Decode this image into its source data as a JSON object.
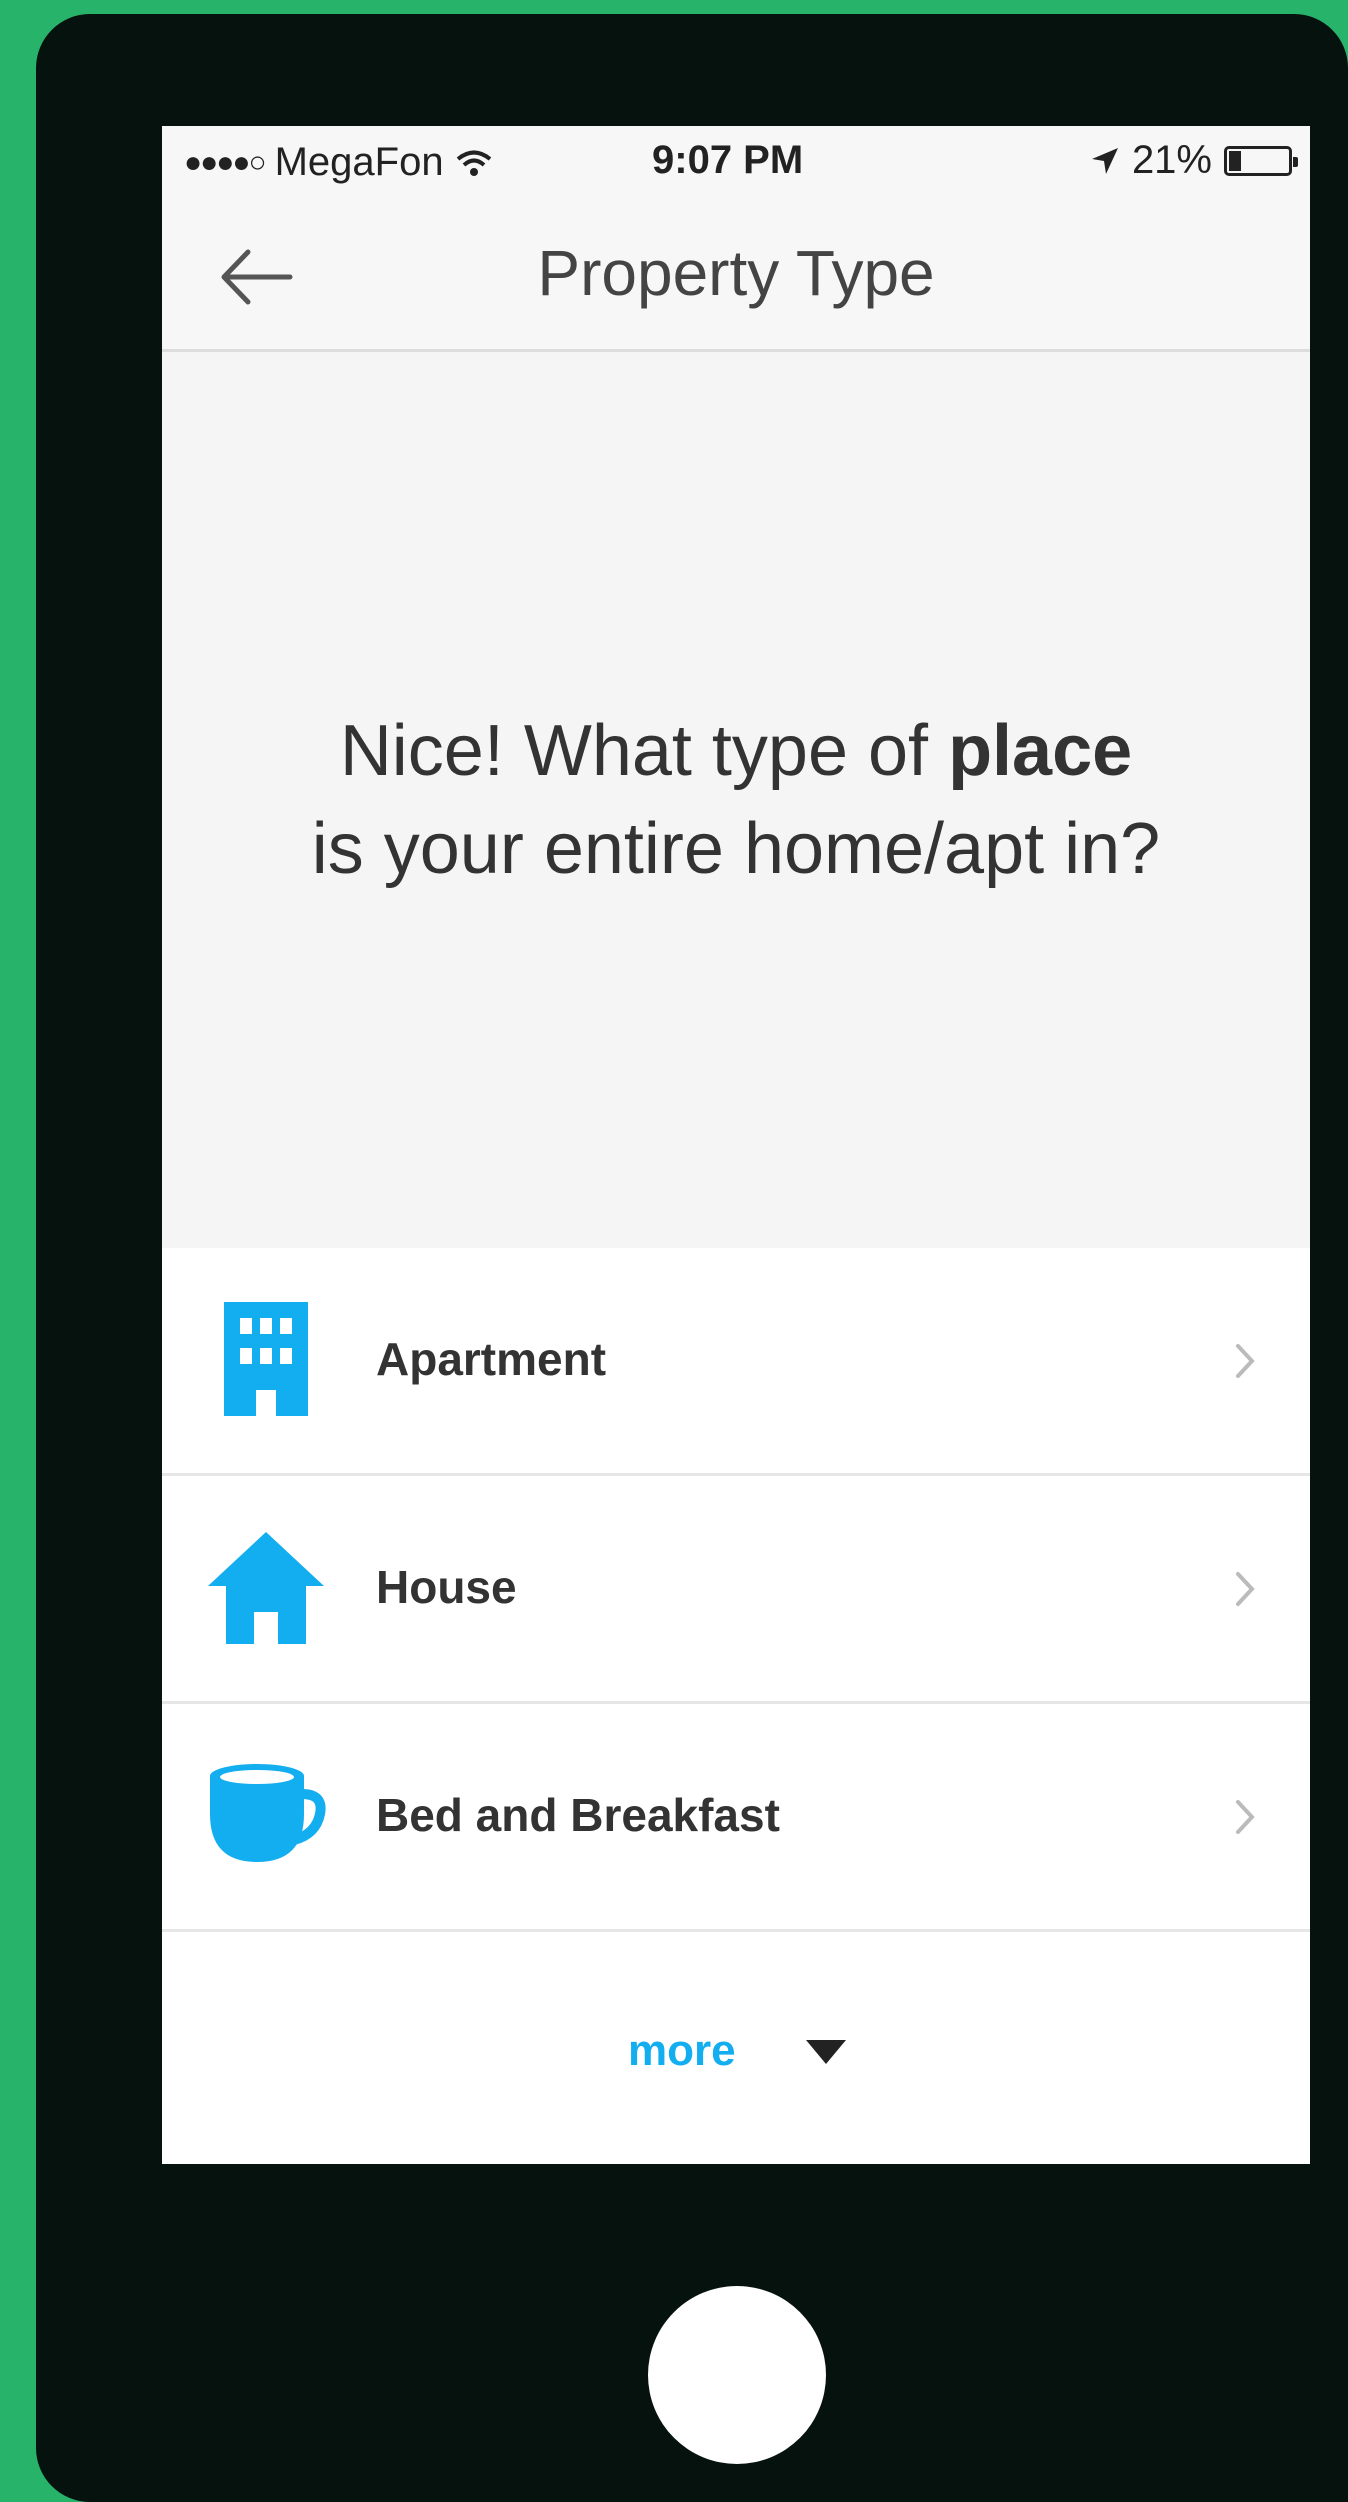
{
  "status_bar": {
    "signal_dots": "●●●●○",
    "carrier": "MegaFon",
    "time": "9:07 PM",
    "battery_percent": "21%",
    "battery_level": 0.21
  },
  "nav": {
    "title": "Property Type"
  },
  "hero": {
    "question_prefix": "Nice! What type of ",
    "question_bold": "place",
    "question_line2": "is your entire home/apt in?"
  },
  "options": [
    {
      "label": "Apartment",
      "icon": "building-icon"
    },
    {
      "label": "House",
      "icon": "house-icon"
    },
    {
      "label": "Bed and Breakfast",
      "icon": "cup-icon"
    }
  ],
  "more": {
    "label": "more"
  },
  "colors": {
    "accent": "#12aef0",
    "background": "#27b36a",
    "phone_body": "#06120e"
  }
}
